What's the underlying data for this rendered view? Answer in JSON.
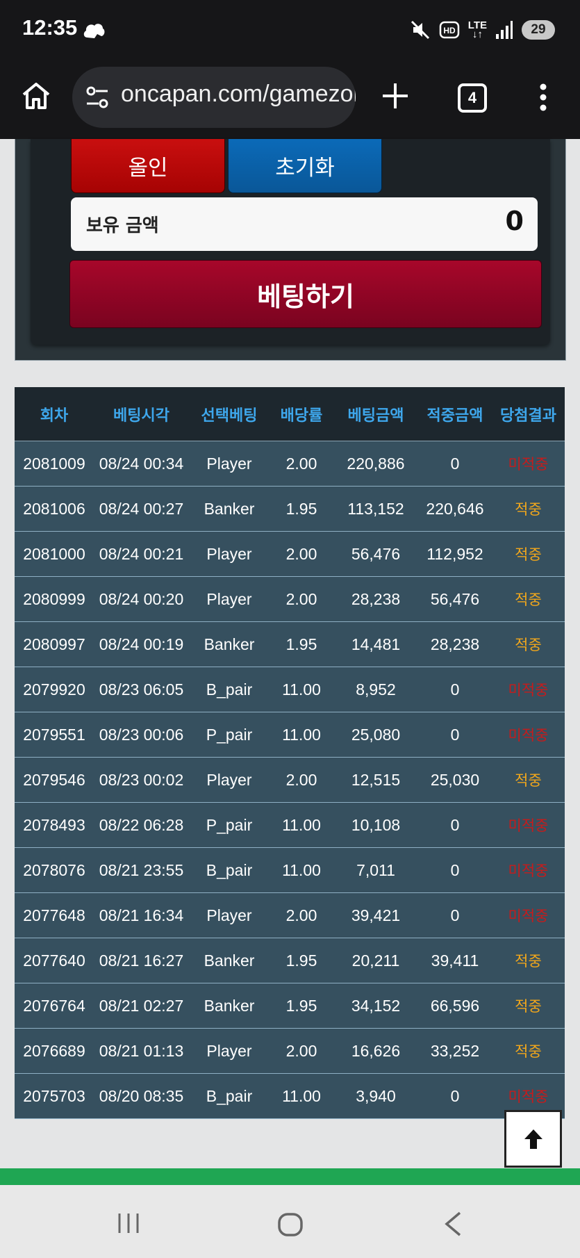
{
  "status_bar": {
    "time": "12:35",
    "network": "LTE",
    "battery": "29"
  },
  "browser": {
    "url": "oncapan.com/gamezone/baccarat",
    "tab_count": "4"
  },
  "betting_panel": {
    "all_in_label": "올인",
    "reset_label": "초기화",
    "balance_label": "보유 금액",
    "balance_value": "0",
    "bet_button_label": "베팅하기"
  },
  "history_table": {
    "headers": [
      "회차",
      "베팅시각",
      "선택베팅",
      "배당률",
      "베팅금액",
      "적중금액",
      "당첨결과"
    ],
    "rows": [
      [
        "2081009",
        "08/24 00:34",
        "Player",
        "2.00",
        "220,886",
        "0",
        "미적중"
      ],
      [
        "2081006",
        "08/24 00:27",
        "Banker",
        "1.95",
        "113,152",
        "220,646",
        "적중"
      ],
      [
        "2081000",
        "08/24 00:21",
        "Player",
        "2.00",
        "56,476",
        "112,952",
        "적중"
      ],
      [
        "2080999",
        "08/24 00:20",
        "Player",
        "2.00",
        "28,238",
        "56,476",
        "적중"
      ],
      [
        "2080997",
        "08/24 00:19",
        "Banker",
        "1.95",
        "14,481",
        "28,238",
        "적중"
      ],
      [
        "2079920",
        "08/23 06:05",
        "B_pair",
        "11.00",
        "8,952",
        "0",
        "미적중"
      ],
      [
        "2079551",
        "08/23 00:06",
        "P_pair",
        "11.00",
        "25,080",
        "0",
        "미적중"
      ],
      [
        "2079546",
        "08/23 00:02",
        "Player",
        "2.00",
        "12,515",
        "25,030",
        "적중"
      ],
      [
        "2078493",
        "08/22 06:28",
        "P_pair",
        "11.00",
        "10,108",
        "0",
        "미적중"
      ],
      [
        "2078076",
        "08/21 23:55",
        "B_pair",
        "11.00",
        "7,011",
        "0",
        "미적중"
      ],
      [
        "2077648",
        "08/21 16:34",
        "Player",
        "2.00",
        "39,421",
        "0",
        "미적중"
      ],
      [
        "2077640",
        "08/21 16:27",
        "Banker",
        "1.95",
        "20,211",
        "39,411",
        "적중"
      ],
      [
        "2076764",
        "08/21 02:27",
        "Banker",
        "1.95",
        "34,152",
        "66,596",
        "적중"
      ],
      [
        "2076689",
        "08/21 01:13",
        "Player",
        "2.00",
        "16,626",
        "33,252",
        "적중"
      ],
      [
        "2075703",
        "08/20 08:35",
        "B_pair",
        "11.00",
        "3,940",
        "0",
        "미적중"
      ]
    ]
  },
  "colors": {
    "win": "#f2a71b",
    "lose": "#c71b1b",
    "header_text": "#3ea7ec",
    "row_bg": "#36505f"
  },
  "icons": {
    "home": "home-icon",
    "site_info": "tune-icon",
    "new_tab": "plus-icon",
    "menu": "more-vert-icon",
    "scroll_top": "arrow-up-icon"
  }
}
